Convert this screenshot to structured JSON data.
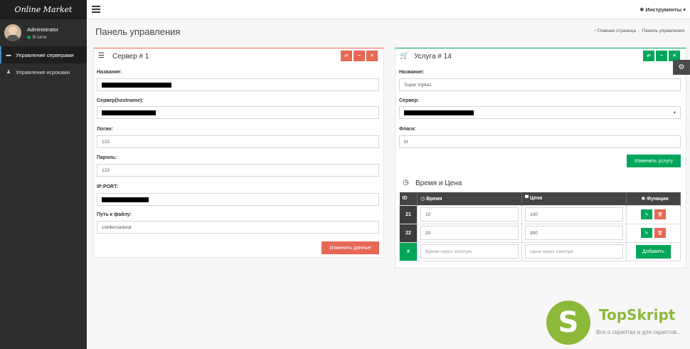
{
  "app": {
    "logo": "Online Market"
  },
  "user": {
    "name": "Administrator",
    "status": "В сети"
  },
  "sidebar": {
    "items": [
      {
        "label": "Управление серверами",
        "icon": "server-icon"
      },
      {
        "label": "Управление игроками",
        "icon": "user-icon"
      }
    ]
  },
  "topbar": {
    "tools_label": "Инструменты"
  },
  "page": {
    "title": "Панель управления",
    "breadcrumb_home": "Главная страница",
    "breadcrumb_current": "Панель управления"
  },
  "server_box": {
    "title": "Сервер # 1",
    "name_label": "Название:",
    "hostname_label": "Сервер(hostname):",
    "login_label": "Логин:",
    "login_value": "123",
    "password_label": "Пароль:",
    "password_value": "123",
    "ipport_label": "IP:PORT:",
    "path_label": "Путь к файлу:",
    "path_value": "cstrike/sadasd",
    "submit_label": "Изменить данные"
  },
  "service_box": {
    "title": "Услуга # 14",
    "name_label": "Название:",
    "name_value": "Super Vipka1",
    "server_label": "Сервер:",
    "flags_label": "Флаги:",
    "flags_value": "bt",
    "submit_label": "Изменить услугу",
    "section_title": "Время и Цена",
    "table": {
      "headers": {
        "id": "ID",
        "time": "Время",
        "price": "Цена",
        "functions": "Функции"
      },
      "rows": [
        {
          "id": "21",
          "time": "10",
          "price": "100"
        },
        {
          "id": "22",
          "time": "20",
          "price": "300"
        }
      ],
      "new_row": {
        "id": "#",
        "time_placeholder": "Время через запятую",
        "price_placeholder": "Цена через запятую",
        "add_label": "Добавить"
      }
    }
  },
  "watermark": {
    "letter": "S",
    "title": "TopSkript",
    "subtitle": "Все о скриптах и для скриптов..."
  },
  "colors": {
    "red": "#e86856",
    "green": "#00a65a",
    "sidebar": "#2d2d2d",
    "watermark": "#8cb93a"
  }
}
